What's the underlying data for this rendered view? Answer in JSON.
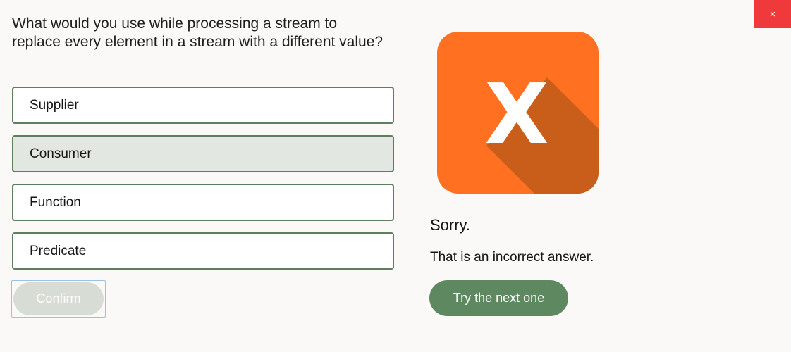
{
  "window": {
    "close_label": "×"
  },
  "quiz": {
    "question": "What would you use while processing a stream to replace every element in a stream with a different value?",
    "options": [
      {
        "label": "Supplier",
        "selected": false
      },
      {
        "label": "Consumer",
        "selected": true
      },
      {
        "label": "Function",
        "selected": false
      },
      {
        "label": "Predicate",
        "selected": false
      }
    ],
    "confirm_label": "Confirm"
  },
  "result": {
    "icon": "x-mark-icon",
    "icon_letter": "X",
    "icon_color": "#ff7120",
    "icon_shadow_color": "#c95e1b",
    "title": "Sorry.",
    "message": "That is an incorrect answer.",
    "next_label": "Try the next one"
  },
  "colors": {
    "option_border": "#5f7d5f",
    "selected_background": "#e2e7e1",
    "primary_button": "#5e8860",
    "close_button": "#f0393b"
  }
}
